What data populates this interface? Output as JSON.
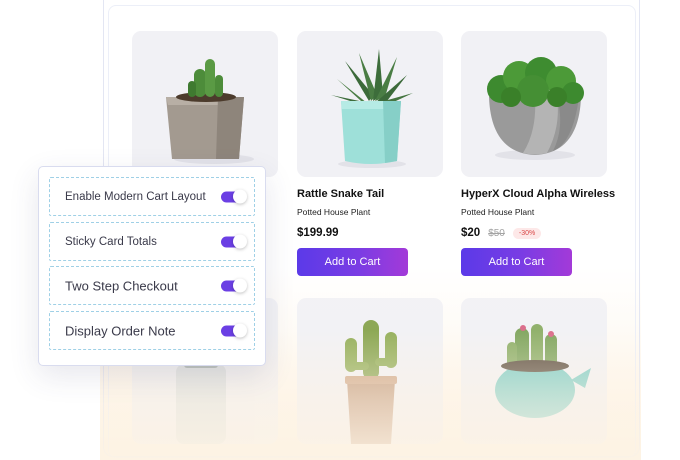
{
  "settings_panel": {
    "items": [
      {
        "label": "Enable Modern Cart Layout",
        "enabled": true
      },
      {
        "label": "Sticky Card Totals",
        "enabled": true
      },
      {
        "label": "Two Step Checkout",
        "enabled": true
      },
      {
        "label": "Display Order Note",
        "enabled": true
      }
    ]
  },
  "products": [
    {
      "name": "",
      "subtitle": "",
      "price": "",
      "image": "cactus-in-square-grey-pot"
    },
    {
      "name": "Rattle Snake Tail",
      "subtitle": "Potted House Plant",
      "price": "$199.99",
      "button": "Add to Cart",
      "image": "aloe-in-mint-pot"
    },
    {
      "name": "HyperX Cloud Alpha Wireless",
      "subtitle": "Potted House Plant",
      "price": "$20",
      "old_price": "$50",
      "discount": "-30%",
      "button": "Add to Cart",
      "image": "moss-in-concrete-pot"
    },
    {
      "name": "",
      "image": "succulent-in-glass-pot"
    },
    {
      "name": "",
      "image": "cactus-in-clay-pot"
    },
    {
      "name": "",
      "image": "cactus-in-teal-teapot"
    }
  ],
  "colors": {
    "accent": "#6b3fe4",
    "button_gradient_start": "#5b3ae8",
    "button_gradient_end": "#a33ad8",
    "discount_text": "#d94848",
    "discount_bg": "#fde8e8",
    "card_bg": "#f1f1f5"
  }
}
